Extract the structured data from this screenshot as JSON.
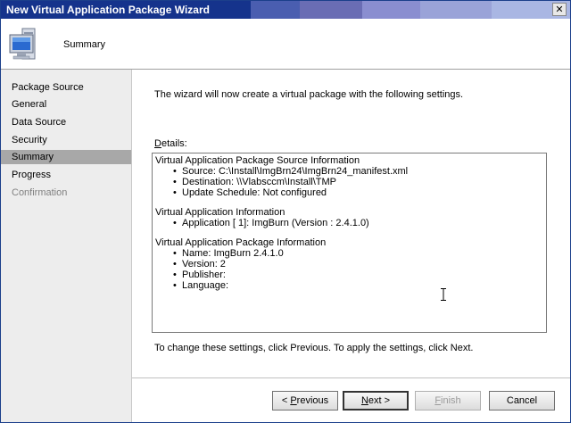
{
  "window": {
    "title": "New Virtual Application Package Wizard",
    "close_glyph": "✕"
  },
  "header": {
    "page_title": "Summary",
    "icon": "computer-icon"
  },
  "nav": {
    "items": [
      {
        "label": "Package Source",
        "state": "normal"
      },
      {
        "label": "General",
        "state": "normal"
      },
      {
        "label": "Data Source",
        "state": "normal"
      },
      {
        "label": "Security",
        "state": "normal"
      },
      {
        "label": "Summary",
        "state": "active"
      },
      {
        "label": "Progress",
        "state": "normal"
      },
      {
        "label": "Confirmation",
        "state": "disabled"
      }
    ]
  },
  "main": {
    "intro": "The wizard will now create a virtual package with the following settings.",
    "details_label_mnemonic": "D",
    "details_label_rest": "etails:",
    "sections": [
      {
        "title": "Virtual Application Package Source Information",
        "bullets": [
          "Source: C:\\Install\\ImgBrn24\\ImgBrn24_manifest.xml",
          "Destination: \\\\Vlabsccm\\Install\\TMP",
          "Update Schedule: Not configured"
        ]
      },
      {
        "title": "Virtual Application Information",
        "bullets": [
          "Application [  1]: ImgBurn (Version : 2.4.1.0)"
        ]
      },
      {
        "title": "Virtual Application Package Information",
        "bullets": [
          "Name: ImgBurn 2.4.1.0",
          "Version: 2",
          "Publisher:",
          "Language:"
        ]
      }
    ],
    "outro": "To change these settings, click Previous. To apply the settings, click Next."
  },
  "buttons": {
    "previous_mnemonic": "P",
    "previous_pre": "< ",
    "previous_rest": "revious",
    "next_mnemonic": "N",
    "next_rest": "ext >",
    "finish_mnemonic": "F",
    "finish_rest": "inish",
    "cancel": "Cancel"
  },
  "colors": {
    "title_bands": [
      "#15338c",
      "#2d49a5",
      "#4b63b4",
      "#6a6db4",
      "#7d83c2",
      "#909cd2",
      "#a6b3e0"
    ],
    "nav_bg": "#ededed",
    "nav_active": "#a8a8a8"
  }
}
